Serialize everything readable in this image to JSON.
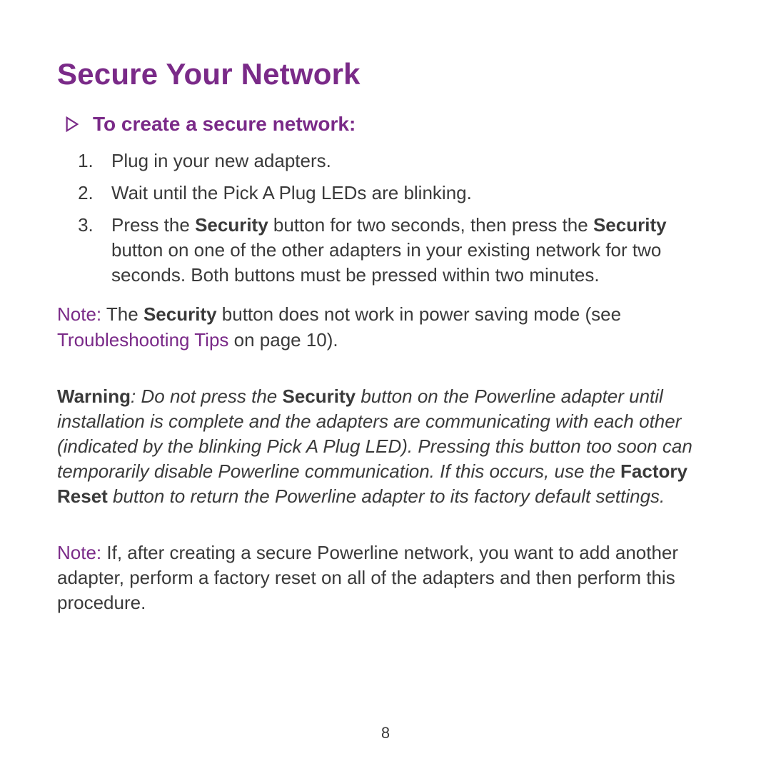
{
  "title": "Secure Your Network",
  "subhead": "To create a secure network:",
  "steps": {
    "s1": "Plug in your new adapters.",
    "s2": "Wait until the Pick A Plug LEDs are blinking.",
    "s3_a": "Press the ",
    "s3_b": "Security",
    "s3_c": " button for two seconds, then press the ",
    "s3_d": "Security",
    "s3_e": " button on one of the other adapters in your existing network for two seconds. Both buttons must be pressed within two minutes."
  },
  "note1": {
    "label": "Note:  ",
    "a": "The ",
    "b": "Security",
    "c": " button does not work in power saving mode (see ",
    "link": "Troubleshooting Tips",
    "d": " on page 10)."
  },
  "warning": {
    "label": "Warning",
    "a": ": Do not press the ",
    "b": "Security",
    "c": " button on the Powerline adapter until installation is complete and the adapters are communicating with each other (indicated by the blinking Pick A Plug LED). Pressing this button too soon can temporarily disable Powerline communication. If this occurs, use the ",
    "d": "Factory Reset",
    "e": " button to return the Powerline adapter to its factory default settings."
  },
  "note2": {
    "label": "Note:  ",
    "text": "If, after creating a secure Powerline network, you want to add another adapter, perform a factory reset on all of the adapters and then perform this procedure."
  },
  "page_number": "8"
}
